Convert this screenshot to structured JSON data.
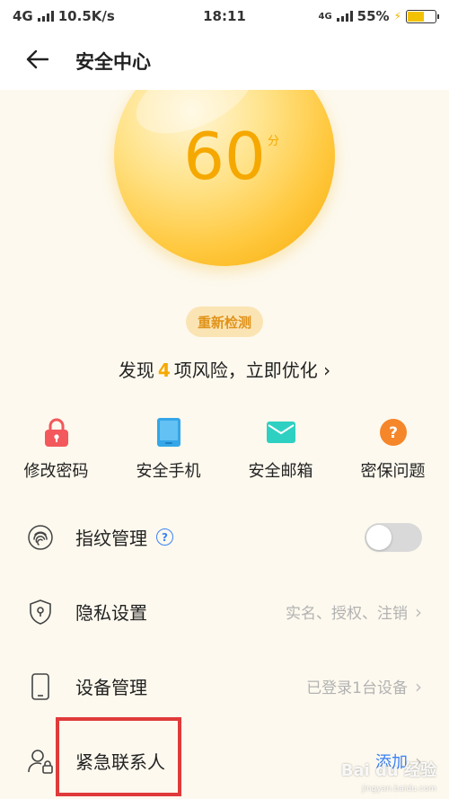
{
  "status_bar": {
    "network": "4G",
    "speed": "10.5K/s",
    "time": "18:11",
    "network_right": "4G",
    "battery": "55%"
  },
  "header": {
    "title": "安全中心"
  },
  "score": {
    "value": "60",
    "unit": "分",
    "recheck_label": "重新检测"
  },
  "risk": {
    "prefix": "发现",
    "count": "4",
    "suffix": "项风险，立即优化",
    "chevron": "›"
  },
  "quick_actions": [
    {
      "label": "修改密码",
      "icon": "lock-icon",
      "color": "#f2585c"
    },
    {
      "label": "安全手机",
      "icon": "phone-icon",
      "color": "#35a6e8"
    },
    {
      "label": "安全邮箱",
      "icon": "mail-icon",
      "color": "#2ed0c2"
    },
    {
      "label": "密保问题",
      "icon": "question-icon",
      "color": "#f5862a"
    }
  ],
  "settings": {
    "fingerprint": {
      "label": "指纹管理",
      "toggle_on": false
    },
    "privacy": {
      "label": "隐私设置",
      "value": "实名、授权、注销"
    },
    "device": {
      "label": "设备管理",
      "value": "已登录1台设备"
    },
    "emergency": {
      "label": "紧急联系人",
      "value": "添加"
    }
  },
  "watermark": {
    "text": "Bai du 经验",
    "sub": "jingyan.baidu.com"
  },
  "colors": {
    "accent": "#f5a800",
    "link": "#3b82f6",
    "highlight": "#e03a3a",
    "background": "#fdf9ee"
  }
}
